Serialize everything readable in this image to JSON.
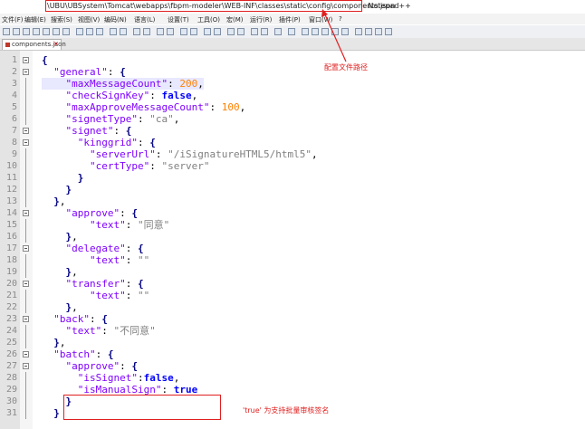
{
  "window": {
    "title_path": "\\UBU\\UBSystem\\Tomcat\\webapps\\fbpm-modeler\\WEB-INF\\classes\\static\\config\\components.json",
    "title_app": "- Notepad++"
  },
  "menu": [
    "文件(F)",
    "编辑(E)",
    "搜索(S)",
    "视图(V)",
    "编码(N)",
    "语言(L)",
    "设置(T)",
    "工具(O)",
    "宏(M)",
    "运行(R)",
    "插件(P)",
    "窗口(W)",
    "?"
  ],
  "tab": {
    "label": "components.json"
  },
  "editor": {
    "lines": [
      {
        "n": "1"
      },
      {
        "n": "2"
      },
      {
        "n": "3"
      },
      {
        "n": "4"
      },
      {
        "n": "5"
      },
      {
        "n": "6"
      },
      {
        "n": "7"
      },
      {
        "n": "8"
      },
      {
        "n": "9"
      },
      {
        "n": "10"
      },
      {
        "n": "11"
      },
      {
        "n": "12"
      },
      {
        "n": "13"
      },
      {
        "n": "14"
      },
      {
        "n": "15"
      },
      {
        "n": "16"
      },
      {
        "n": "17"
      },
      {
        "n": "18"
      },
      {
        "n": "19"
      },
      {
        "n": "20"
      },
      {
        "n": "21"
      },
      {
        "n": "22"
      },
      {
        "n": "23"
      },
      {
        "n": "24"
      },
      {
        "n": "25"
      },
      {
        "n": "26"
      },
      {
        "n": "27"
      },
      {
        "n": "28"
      },
      {
        "n": "29"
      },
      {
        "n": "30"
      },
      {
        "n": "31"
      }
    ],
    "tokens": {
      "general": "\"general\"",
      "maxMessageCount": "\"maxMessageCount\"",
      "v200": "200",
      "checkSignKey": "\"checkSignKey\"",
      "false": "false",
      "maxApproveMessageCount": "\"maxApproveMessageCount\"",
      "v100": "100",
      "signetType": "\"signetType\"",
      "ca": "\"ca\"",
      "signet": "\"signet\"",
      "kinggrid": "\"kinggrid\"",
      "serverUrl": "\"serverUrl\"",
      "serverUrlVal": "\"/iSignatureHTML5/html5\"",
      "certType": "\"certType\"",
      "server": "\"server\"",
      "approve": "\"approve\"",
      "text": "\"text\"",
      "agree": "\"同意\"",
      "delegate": "\"delegate\"",
      "empty": "\"\"",
      "transfer": "\"transfer\"",
      "back": "\"back\"",
      "disagree": "\"不同意\"",
      "batch": "\"batch\"",
      "isSignet": "\"isSignet\"",
      "isManualSign": "\"isManualSign\"",
      "true": "true"
    }
  },
  "annotations": {
    "config_path_note": "配置文件路径",
    "true_note": "'true' 为支持批量审核签名"
  },
  "colors": {
    "annotation": "#e02020",
    "keyword": "#0000ff",
    "string": "#808080",
    "number": "#ff8000",
    "key": "#8000ff"
  }
}
